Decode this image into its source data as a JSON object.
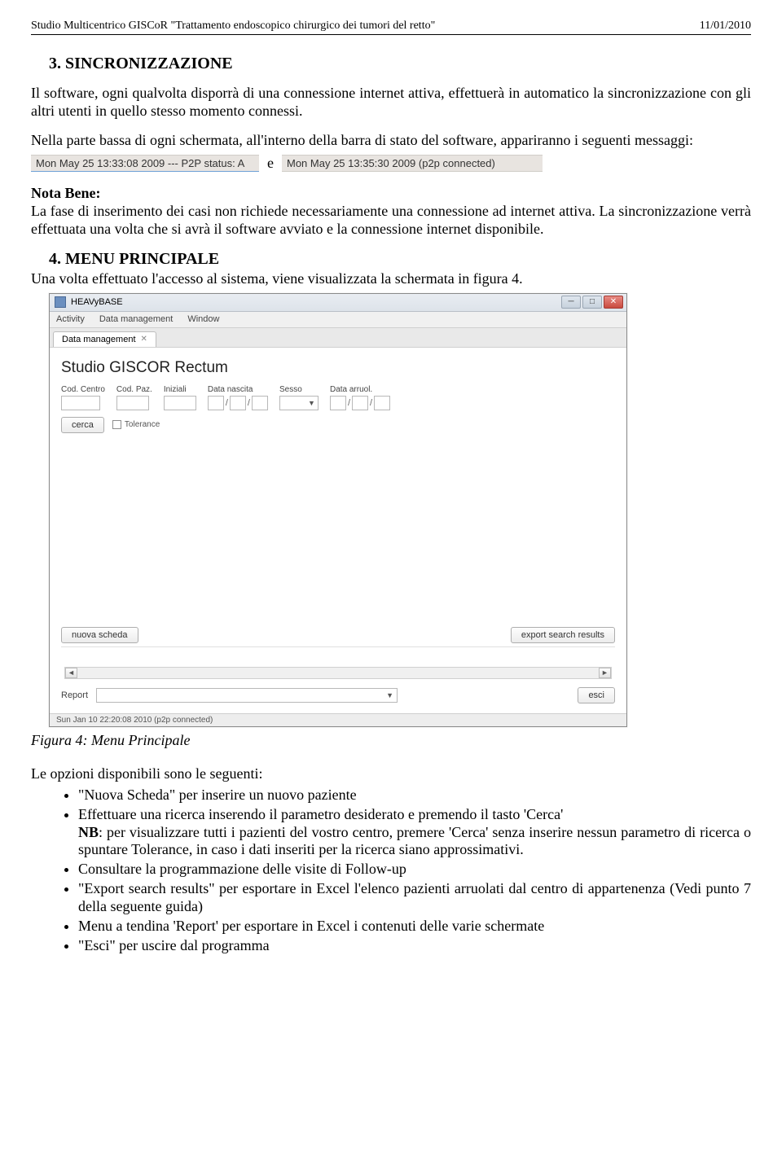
{
  "header": {
    "left": "Studio Multicentrico GISCoR \"Trattamento endoscopico chirurgico dei tumori del retto\"",
    "right": "11/01/2010"
  },
  "sec3": {
    "title": "3. SINCRONIZZAZIONE",
    "p1": "Il software, ogni qualvolta disporrà di una connessione internet attiva, effettuerà in automatico la sincronizzazione con gli altri utenti in quello stesso momento connessi.",
    "p2": "Nella parte bassa di ogni schermata, all'interno della barra di stato del software, appariranno i seguenti messaggi:",
    "status1": "Mon May 25 13:33:08 2009 --- P2P status: A",
    "e": "e",
    "status2": "Mon May 25 13:35:30 2009  (p2p connected)",
    "notaBeneLabel": "Nota Bene:",
    "notaBeneText": "La fase di inserimento dei casi non richiede necessariamente una connessione ad internet attiva. La sincronizzazione verrà effettuata una volta che si avrà il software avviato e la connessione internet disponibile."
  },
  "sec4": {
    "title": "4. MENU PRINCIPALE",
    "intro": "Una volta effettuato l'accesso al sistema, viene visualizzata la schermata in figura 4.",
    "figcaption": "Figura 4: Menu Principale",
    "optionsIntro": "Le opzioni disponibili sono le seguenti:",
    "bullets": {
      "b1": "\"Nuova Scheda\" per inserire un nuovo paziente",
      "b2a": "Effettuare una ricerca inserendo il parametro desiderato e premendo il tasto 'Cerca'",
      "b2b_bold": "NB",
      "b2b_rest": ": per visualizzare tutti i pazienti del vostro centro, premere 'Cerca' senza inserire nessun parametro di ricerca o spuntare Tolerance, in caso i dati inseriti per la ricerca siano approssimativi.",
      "b3": "Consultare la programmazione delle visite di Follow-up",
      "b4": "\"Export search results\" per esportare in Excel l'elenco pazienti arruolati dal centro di appartenenza (Vedi punto 7 della seguente guida)",
      "b5": "Menu a tendina 'Report' per esportare in Excel i contenuti delle varie schermate",
      "b6": "\"Esci\" per uscire dal programma"
    }
  },
  "app": {
    "title": "HEAVyBASE",
    "menu": {
      "activity": "Activity",
      "dataMgmt": "Data management",
      "window": "Window"
    },
    "tab": "Data management",
    "studyTitle": "Studio GISCOR Rectum",
    "fields": {
      "codCentro": "Cod. Centro",
      "codPaz": "Cod. Paz.",
      "iniziali": "Iniziali",
      "dataNascita": "Data nascita",
      "sesso": "Sesso",
      "dataArruol": "Data arruol."
    },
    "buttons": {
      "cerca": "cerca",
      "tolerance": "Tolerance",
      "nuovaScheda": "nuova scheda",
      "exportResults": "export search results",
      "esci": "esci"
    },
    "reportLabel": "Report",
    "statusbar": "Sun Jan 10 22:20:08 2010 (p2p connected)",
    "dropdown_arrow": "▼",
    "slash": "/"
  }
}
